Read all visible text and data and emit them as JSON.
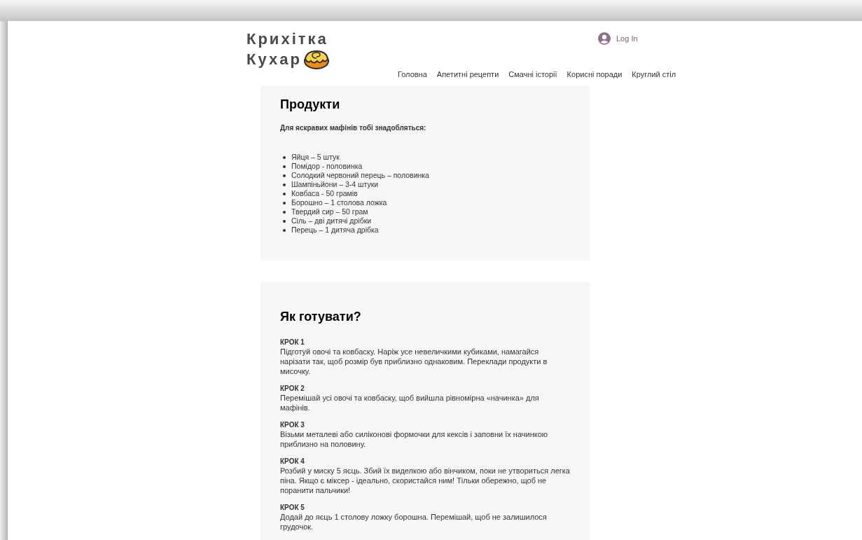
{
  "logo": {
    "lines": [
      "Крихітка",
      "Кухар"
    ]
  },
  "login": {
    "label": "Log In"
  },
  "nav": [
    {
      "label": "Головна"
    },
    {
      "label": "Апетитні рецепти"
    },
    {
      "label": "Смачні історії"
    },
    {
      "label": "Корисні поради"
    },
    {
      "label": "Круглий стіл"
    }
  ],
  "ingredients": {
    "title": "Продукти",
    "intro": "Для яскравих мафінів тобі знадобляться:",
    "items": [
      "Яйця – 5 штук",
      "Помідор - половинка",
      "Солодкий червоний перець – половинка",
      "Шампіньйони – 3-4 штуки",
      "Ковбаса - 50 грамів",
      "Борошно – 1 столова ложка",
      "Твердий сир – 50 грам",
      "Сіль – дві дитячі дрібки",
      "Перець – 1 дитяча дрібка"
    ]
  },
  "steps": {
    "title": "Як готувати?",
    "items": [
      {
        "label": "КРОК 1",
        "text": "Підготуй овочі та ковбаску.  Наріж усе невеличкими кубиками, намагайся нарізати так, щоб розмір був приблизно однаковим. Переклади продукти в мисочку."
      },
      {
        "label": "КРОК 2",
        "text": "Перемішай усі овочі та ковбаску, щоб вийшла рівномірна «начинка» для мафінів."
      },
      {
        "label": "КРОК 3",
        "text": "Візьми металеві або силіконові формочки для кексів  і заповни їх начинкою приблизно на половину."
      },
      {
        "label": "КРОК 4",
        "text": "Розбий у миску 5 яєць. Збий їх виделкою або вінчиком, поки не утвориться легка піна. Якщо є міксер - ідеально, скористайся ним! Тільки обережно, щоб не поранити пальчики!"
      },
      {
        "label": "КРОК 5",
        "text": "Додай до яєць 1 столову ложку борошна. Перемішай, щоб не залишилося грудочок."
      }
    ]
  }
}
